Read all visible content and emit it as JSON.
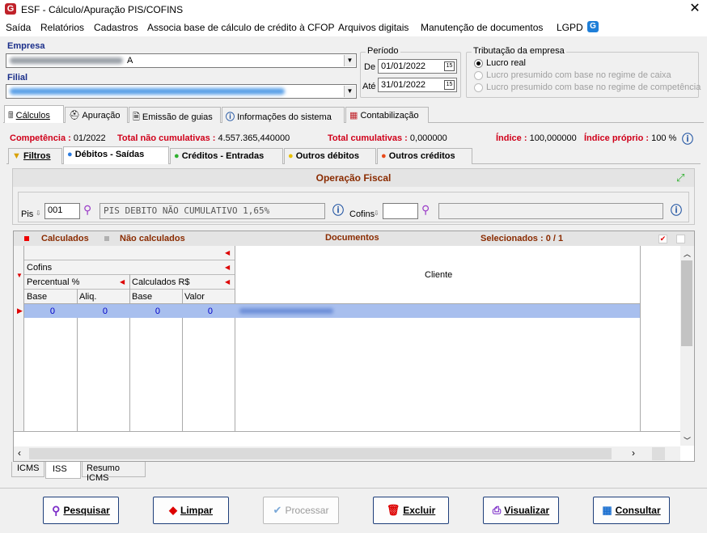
{
  "window": {
    "title": "ESF - Cálculo/Apuração PIS/COFINS",
    "close": "✕"
  },
  "menu": [
    "Saída",
    "Relatórios",
    "Cadastros",
    "Associa base de cálculo de crédito à CFOP",
    "Arquivos digitais",
    "Manutenção de documentos",
    "LGPD"
  ],
  "empresa": {
    "label": "Empresa",
    "value": "A"
  },
  "filial": {
    "label": "Filial"
  },
  "periodo": {
    "caption": "Período",
    "de_label": "De",
    "de_value": "01/01/2022",
    "ate_label": "Até",
    "ate_value": "31/01/2022",
    "cal_icon": "15"
  },
  "tributacao": {
    "caption": "Tributação da empresa",
    "options": [
      "Lucro real",
      "Lucro presumido com base no regime de caixa",
      "Lucro presumido com base no regime de competência"
    ],
    "selected": 0
  },
  "main_tabs": [
    "Cálculos",
    "Apuração",
    "Emissão de guias",
    "Informações do sistema",
    "Contabilização"
  ],
  "summary": {
    "competencia_label": "Competência :",
    "competencia_value": "01/2022",
    "total_nc_label": "Total não cumulativas :",
    "total_nc_value": "4.557.365,440000",
    "total_c_label": "Total cumulativas :",
    "total_c_value": "0,000000",
    "indice_label": "Índice :",
    "indice_value": "100,000000",
    "indice_proprio_label": "Índice próprio :",
    "indice_proprio_value": "100 %"
  },
  "sub_tabs": [
    "Filtros",
    "Débitos - Saídas",
    "Créditos - Entradas",
    "Outros débitos",
    "Outros créditos"
  ],
  "operacao": {
    "title": "Operação Fiscal",
    "pis_label": "Pis",
    "pis_code": "001",
    "pis_desc": "PIS DEBITO NÃO CUMULATIVO 1,65%",
    "cofins_label": "Cofins",
    "cofins_code": "",
    "cofins_desc": ""
  },
  "grid": {
    "legend_calc": "Calculados",
    "legend_nao": "Não calculados",
    "documentos": "Documentos",
    "selecionados": "Selecionados : 0 / 1",
    "cofins": "Cofins",
    "percentual": "Percentual %",
    "calculados_rs": "Calculados R$",
    "base": "Base",
    "aliq": "Aliq.",
    "base2": "Base",
    "valor": "Valor",
    "cliente": "Cliente",
    "row": [
      "0",
      "0",
      "0",
      "0"
    ]
  },
  "bottom_tabs": [
    "ICMS",
    "ISS",
    "Resumo ICMS"
  ],
  "buttons": [
    "Pesquisar",
    "Limpar",
    "Processar",
    "Excluir",
    "Visualizar",
    "Consultar"
  ]
}
